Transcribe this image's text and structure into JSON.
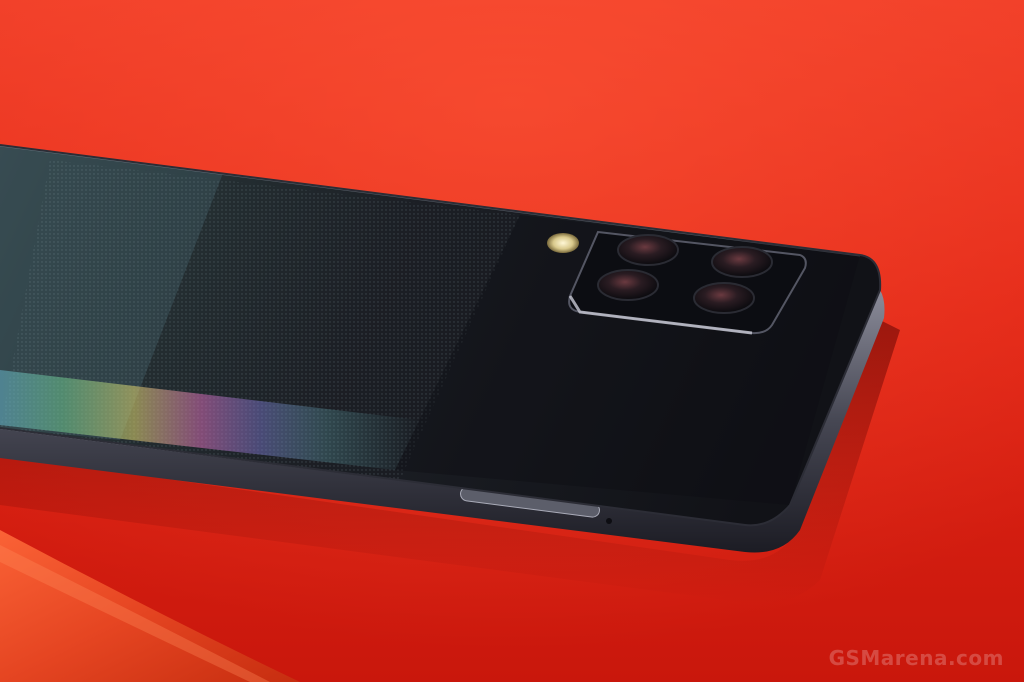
{
  "photo": {
    "subject": "phone-back",
    "colors": {
      "surface": "#e52a1a",
      "surface_dark": "#a80c06",
      "phone_body": "#16171d",
      "camera_island": "#0c0d12",
      "frame": "#4c4d58"
    }
  },
  "watermark": {
    "text": "GSMarena.com"
  }
}
